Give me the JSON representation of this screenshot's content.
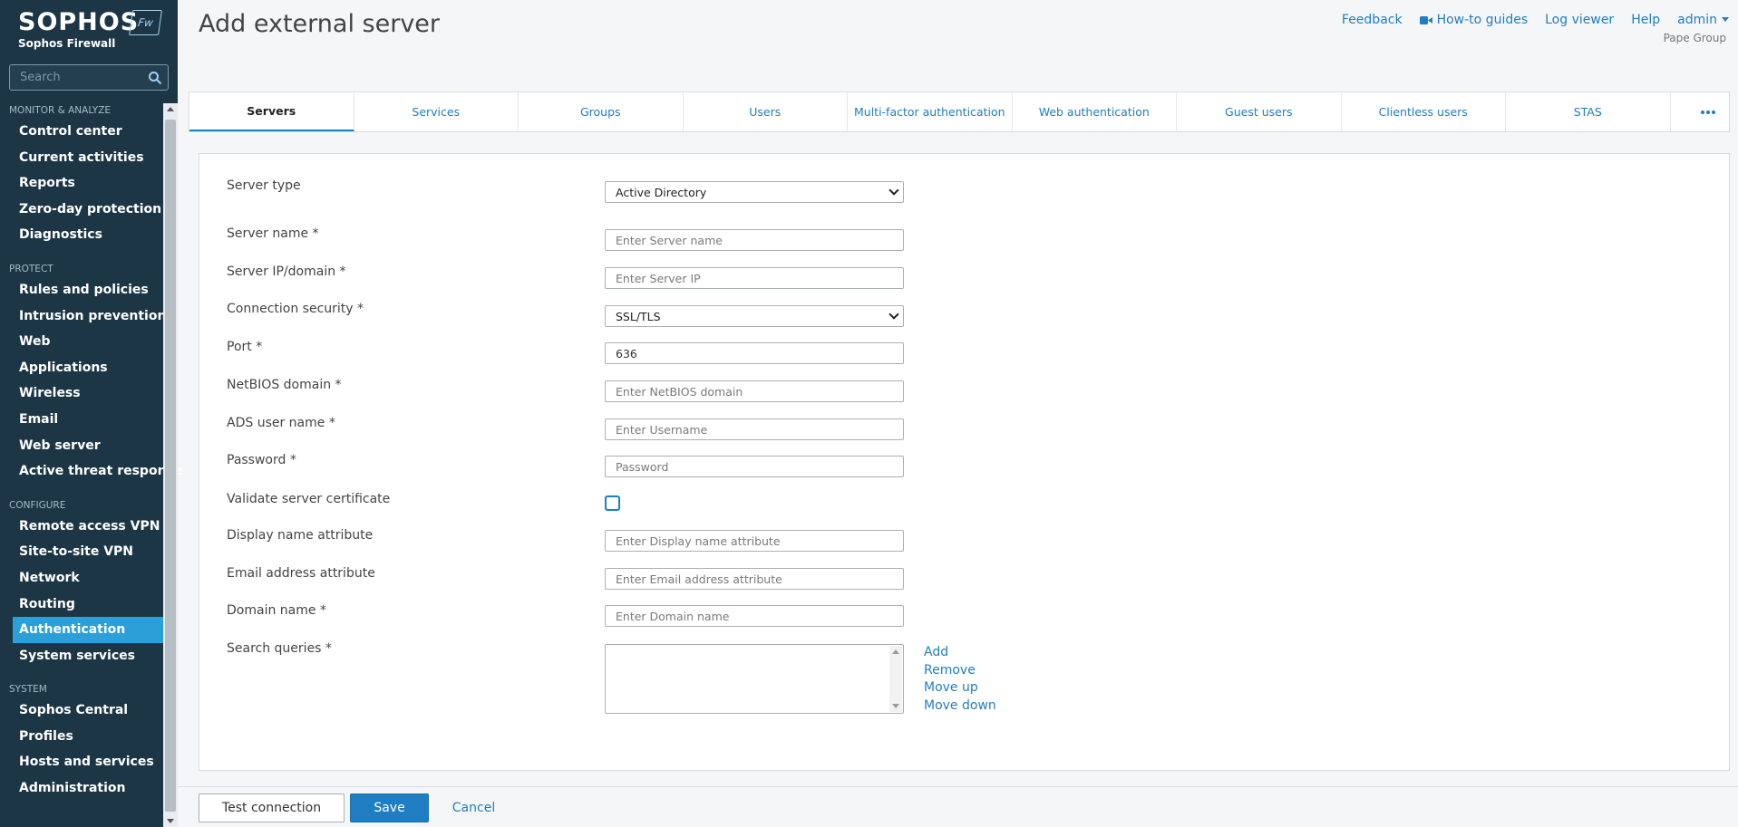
{
  "brand": {
    "logo": "SOPHOS",
    "badge": "Fw",
    "product": "Sophos Firewall"
  },
  "sidebar": {
    "search_placeholder": "Search",
    "sections": [
      {
        "title": "MONITOR & ANALYZE",
        "items": [
          "Control center",
          "Current activities",
          "Reports",
          "Zero-day protection",
          "Diagnostics"
        ]
      },
      {
        "title": "PROTECT",
        "items": [
          "Rules and policies",
          "Intrusion prevention",
          "Web",
          "Applications",
          "Wireless",
          "Email",
          "Web server",
          "Active threat response"
        ]
      },
      {
        "title": "CONFIGURE",
        "items": [
          "Remote access VPN",
          "Site-to-site VPN",
          "Network",
          "Routing",
          "Authentication",
          "System services"
        ]
      },
      {
        "title": "SYSTEM",
        "items": [
          "Sophos Central",
          "Profiles",
          "Hosts and services",
          "Administration"
        ]
      }
    ],
    "active_item": "Authentication"
  },
  "header": {
    "title": "Add external server",
    "links": {
      "feedback": "Feedback",
      "howto": "How-to guides",
      "logviewer": "Log viewer",
      "help": "Help",
      "admin": "admin"
    },
    "org": "Pape Group"
  },
  "tabs": [
    "Servers",
    "Services",
    "Groups",
    "Users",
    "Multi-factor authentication",
    "Web authentication",
    "Guest users",
    "Clientless users",
    "STAS"
  ],
  "active_tab": "Servers",
  "form": {
    "server_type": {
      "label": "Server type",
      "value": "Active Directory"
    },
    "server_name": {
      "label": "Server name *",
      "placeholder": "Enter Server name"
    },
    "server_ip": {
      "label": "Server IP/domain *",
      "placeholder": "Enter Server IP"
    },
    "connection_security": {
      "label": "Connection security *",
      "value": "SSL/TLS"
    },
    "port": {
      "label": "Port *",
      "value": "636"
    },
    "netbios": {
      "label": "NetBIOS domain *",
      "placeholder": "Enter NetBIOS domain"
    },
    "ads_user": {
      "label": "ADS user name *",
      "placeholder": "Enter Username"
    },
    "password": {
      "label": "Password *",
      "placeholder": "Password"
    },
    "validate_cert": {
      "label": "Validate server certificate",
      "checked": false
    },
    "display_name_attr": {
      "label": "Display name attribute",
      "placeholder": "Enter Display name attribute"
    },
    "email_attr": {
      "label": "Email address attribute",
      "placeholder": "Enter Email address attribute"
    },
    "domain_name": {
      "label": "Domain name *",
      "placeholder": "Enter Domain name"
    },
    "search_queries": {
      "label": "Search queries *",
      "actions": {
        "add": "Add",
        "remove": "Remove",
        "move_up": "Move up",
        "move_down": "Move down"
      }
    }
  },
  "footer": {
    "test": "Test connection",
    "save": "Save",
    "cancel": "Cancel"
  },
  "colors": {
    "sidebar_bg": "#1c3646",
    "accent": "#1f7ec2",
    "active_nav": "#2a9fd8"
  }
}
